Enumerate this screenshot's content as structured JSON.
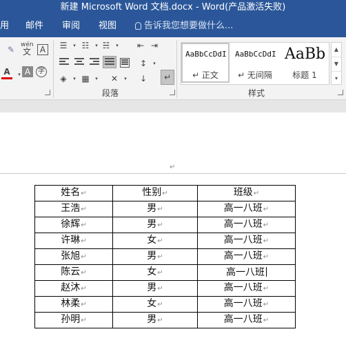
{
  "window": {
    "title": "新建 Microsoft Word 文档.docx - Word(产品激活失败)"
  },
  "tabs": [
    "用",
    "邮件",
    "审阅",
    "视图"
  ],
  "tell_me": "告诉我您想要做什么...",
  "ribbon": {
    "font_group": {
      "phonetic_label": "wén",
      "phonetic_char": "文",
      "char_border": "A",
      "font_color": "A",
      "shade": "A",
      "enclose": "字"
    },
    "paragraph_label": "段落",
    "styles_label": "样式",
    "styles": [
      {
        "sample": "AaBbCcDdI",
        "name": "↵ 正文",
        "active": true
      },
      {
        "sample": "AaBbCcDdI",
        "name": "↵ 无间隔",
        "active": false
      },
      {
        "sample": "AaBb",
        "name": "标题 1",
        "active": false
      }
    ]
  },
  "document": {
    "table": {
      "header": [
        "姓名",
        "性别",
        "班级"
      ],
      "rows": [
        [
          "王浩",
          "男",
          "高一八班"
        ],
        [
          "徐辉",
          "男",
          "高一八班"
        ],
        [
          "许琳",
          "女",
          "高一八班"
        ],
        [
          "张旭",
          "男",
          "高一八班"
        ],
        [
          "陈云",
          "女",
          "高一八班"
        ],
        [
          "赵沐",
          "男",
          "高一八班"
        ],
        [
          "林柔",
          "女",
          "高一八班"
        ],
        [
          "孙明",
          "男",
          "高一八班"
        ]
      ]
    }
  }
}
